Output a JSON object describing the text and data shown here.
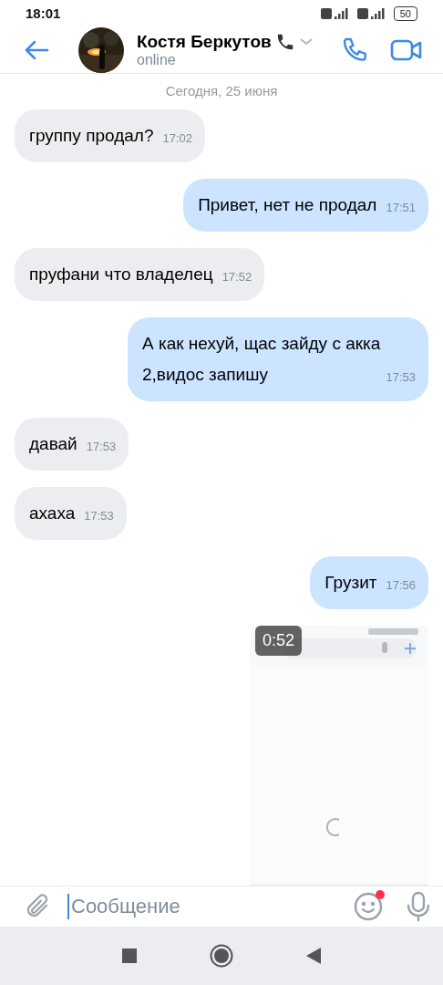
{
  "status_bar": {
    "time": "18:01",
    "battery": "50"
  },
  "header": {
    "name": "Костя Беркутов",
    "status": "online"
  },
  "date": "Сегодня, 25 июня",
  "messages": [
    {
      "kind": "incoming",
      "text": "группу продал?",
      "time": "17:02"
    },
    {
      "kind": "outgoing",
      "text": "Привет, нет не продал",
      "time": "17:51"
    },
    {
      "kind": "incoming",
      "text": "пруфани что владелец",
      "time": "17:52"
    },
    {
      "kind": "outgoing",
      "text": "А как нехуй, щас зайду с акка 2,видос запишу",
      "time": "17:53"
    },
    {
      "kind": "incoming",
      "text": "давай",
      "time": "17:53"
    },
    {
      "kind": "incoming",
      "text": "ахаха",
      "time": "17:53"
    },
    {
      "kind": "outgoing",
      "text": "Грузит",
      "time": "17:56"
    },
    {
      "kind": "video",
      "duration": "0:52"
    }
  ],
  "composer": {
    "placeholder": "Сообщение",
    "emoji_badge": true
  }
}
